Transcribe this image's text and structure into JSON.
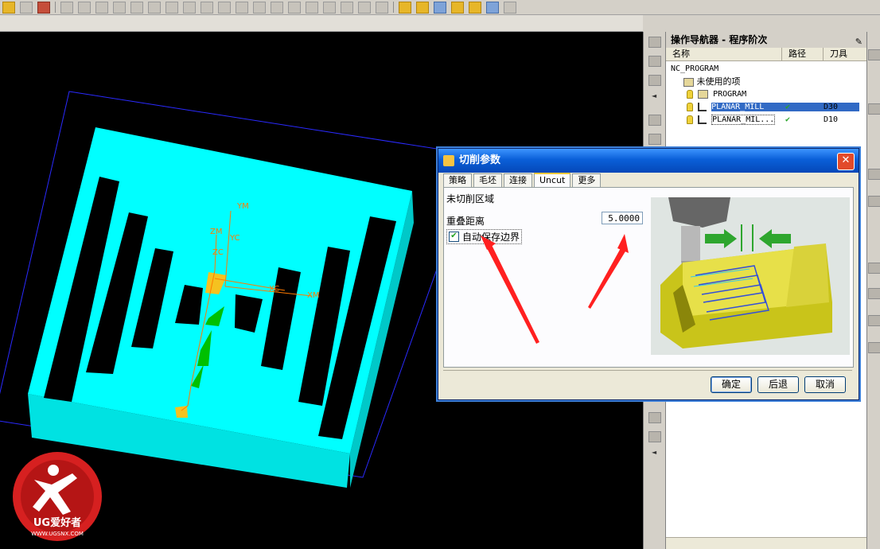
{
  "navigator": {
    "title": "操作导航器 - 程序阶次",
    "columns": [
      "名称",
      "路径",
      "刀具"
    ],
    "tree": [
      {
        "label": "NC_PROGRAM",
        "path": "",
        "tool": ""
      },
      {
        "label": "未使用的项",
        "path": "",
        "tool": ""
      },
      {
        "label": "PROGRAM",
        "path": "",
        "tool": ""
      },
      {
        "label": "PLANAR_MILL",
        "path": "✔",
        "tool": "D30"
      },
      {
        "label": "PLANAR_MIL...",
        "path": "✔",
        "tool": "D10"
      }
    ]
  },
  "dialog": {
    "title": "切削参数",
    "close": "✕",
    "tabs": [
      "策略",
      "毛坯",
      "连接",
      "Uncut",
      "更多"
    ],
    "active_tab": "Uncut",
    "section_title": "未切削区域",
    "overlap_label": "重叠距离",
    "overlap_value": "5.0000",
    "auto_save_label": "自动保存边界",
    "auto_save_checked": true,
    "buttons": {
      "ok": "确定",
      "back": "后退",
      "cancel": "取消"
    }
  },
  "viewport": {
    "axis_labels": [
      "YM",
      "ZM",
      "YC",
      "ZC",
      "XC",
      "XM"
    ]
  },
  "watermark": {
    "brand": "UG爱好者",
    "url": "WWW.UGSNX.COM"
  },
  "colors": {
    "part": "#00ffff",
    "viewport_bg": "#000000",
    "arrow": "#ff2020",
    "title_bar": "#0a5fd8"
  }
}
